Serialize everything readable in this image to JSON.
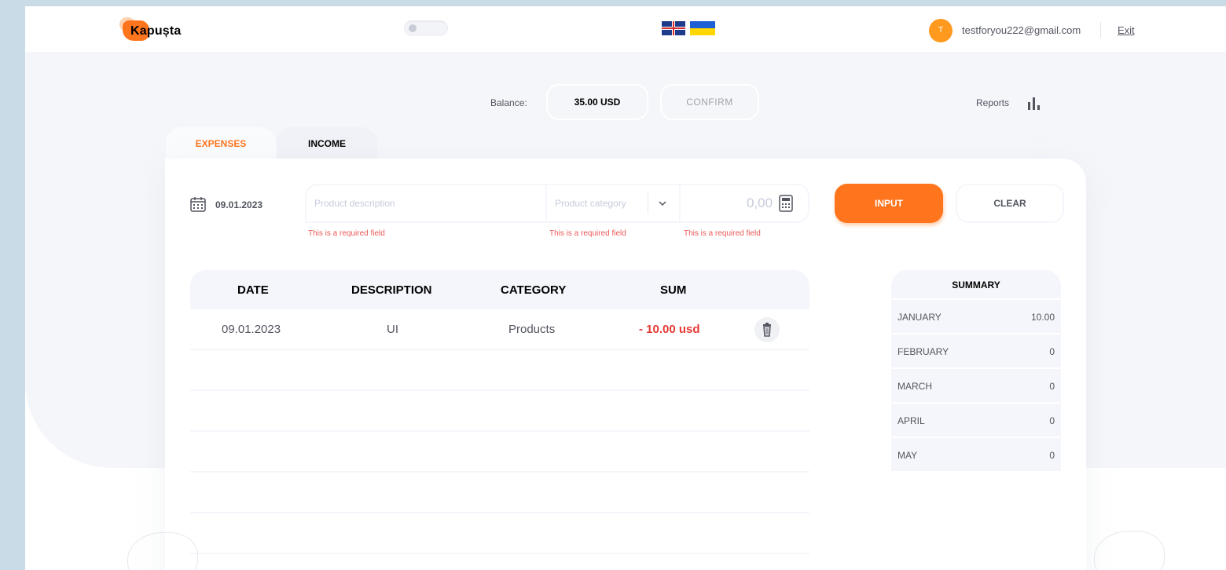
{
  "header": {
    "logo_text": "Kapușta",
    "avatar_initial": "T",
    "email": "testforyou222@gmail.com",
    "exit_label": "Exit"
  },
  "balance": {
    "label": "Balance:",
    "value": "35.00 USD",
    "confirm_label": "CONFIRM"
  },
  "reports": {
    "label": "Reports"
  },
  "tabs": [
    {
      "label": "EXPENSES",
      "active": true
    },
    {
      "label": "INCOME",
      "active": false
    }
  ],
  "form": {
    "date": "09.01.2023",
    "description_placeholder": "Product description",
    "category_placeholder": "Product category",
    "sum_placeholder": "0,00",
    "error_text": "This is a required field",
    "input_button": "INPUT",
    "clear_button": "CLEAR"
  },
  "table": {
    "headers": [
      "DATE",
      "DESCRIPTION",
      "CATEGORY",
      "SUM"
    ],
    "rows": [
      {
        "date": "09.01.2023",
        "description": "UI",
        "category": "Products",
        "sum": "- 10.00 usd"
      }
    ]
  },
  "summary": {
    "title": "SUMMARY",
    "months": [
      {
        "month": "JANUARY",
        "value": "10.00"
      },
      {
        "month": "FEBRUARY",
        "value": "0"
      },
      {
        "month": "MARCH",
        "value": "0"
      },
      {
        "month": "APRIL",
        "value": "0"
      },
      {
        "month": "MAY",
        "value": "0"
      }
    ]
  },
  "colors": {
    "accent": "#ff751d",
    "expense_red": "#e53935",
    "error": "#eb5757",
    "background": "#c9dbe6"
  },
  "icons": [
    "calendar-icon",
    "chevron-down-icon",
    "calculator-icon",
    "trash-icon",
    "bar-chart-icon"
  ]
}
